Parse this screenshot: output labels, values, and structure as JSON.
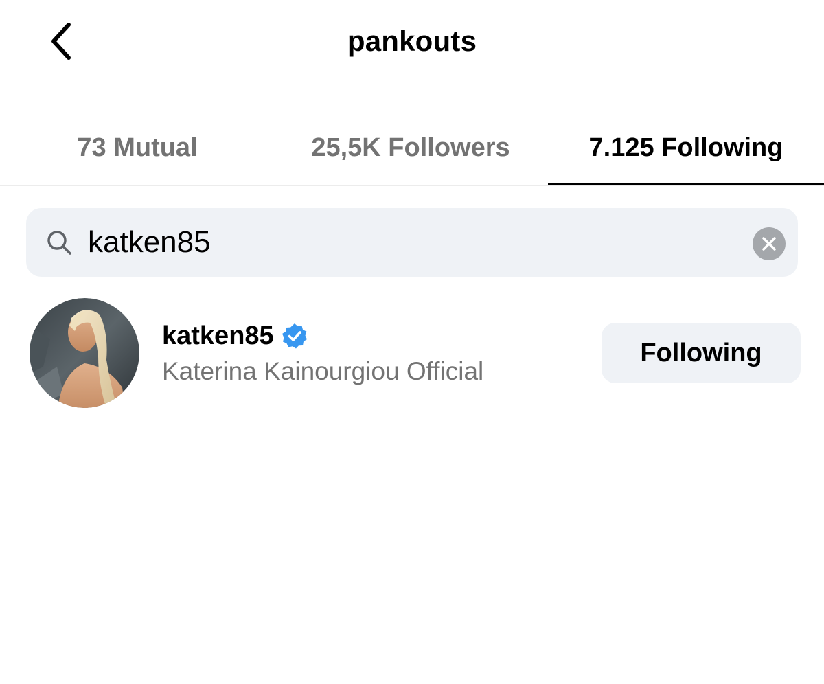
{
  "header": {
    "title": "pankouts",
    "back_icon": "chevron-left-icon"
  },
  "tabs": [
    {
      "label": "73 Mutual",
      "active": false
    },
    {
      "label": "25,5K Followers",
      "active": false
    },
    {
      "label": "7.125 Following",
      "active": true
    }
  ],
  "search": {
    "icon": "search-icon",
    "value": "katken85",
    "clear_icon": "clear-icon"
  },
  "results": [
    {
      "username": "katken85",
      "verified": true,
      "full_name": "Katerina Kainourgiou Official",
      "button_label": "Following"
    }
  ],
  "colors": {
    "text_primary": "#000000",
    "text_secondary": "#737373",
    "input_bg": "#eff2f6",
    "verified_blue": "#3897f0"
  }
}
